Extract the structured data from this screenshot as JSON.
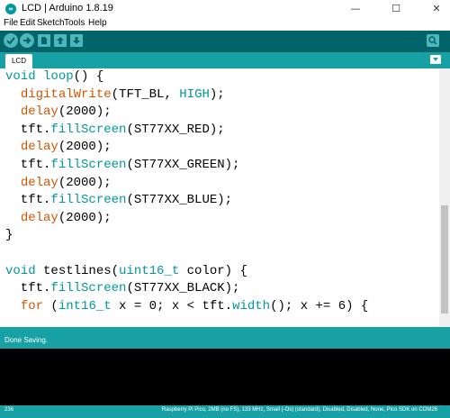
{
  "window": {
    "title": "LCD | Arduino 1.8.19",
    "icon_label": "∞",
    "minimize": "—",
    "maximize": "☐",
    "close": "✕"
  },
  "menu": {
    "items": [
      {
        "label": "File"
      },
      {
        "label": "Edit"
      },
      {
        "label": "Sketch"
      },
      {
        "label": "Tools"
      },
      {
        "label": "Help"
      }
    ]
  },
  "toolbar": {
    "icons": [
      "verify-icon",
      "upload-icon",
      "new-icon",
      "open-icon",
      "save-icon",
      "serial-monitor-icon"
    ]
  },
  "tabs": [
    {
      "label": "LCD"
    }
  ],
  "code": {
    "lines": [
      [
        {
          "t": "void",
          "c": "kw"
        },
        {
          "t": " "
        },
        {
          "t": "loop",
          "c": "kw"
        },
        {
          "t": "() {"
        }
      ],
      [
        {
          "t": "  "
        },
        {
          "t": "digitalWrite",
          "c": "fn"
        },
        {
          "t": "(TFT_BL, "
        },
        {
          "t": "HIGH",
          "c": "kw"
        },
        {
          "t": ");"
        }
      ],
      [
        {
          "t": "  "
        },
        {
          "t": "delay",
          "c": "fn"
        },
        {
          "t": "(2000);"
        }
      ],
      [
        {
          "t": "  tft."
        },
        {
          "t": "fillScreen",
          "c": "kw"
        },
        {
          "t": "(ST77XX_RED);"
        }
      ],
      [
        {
          "t": "  "
        },
        {
          "t": "delay",
          "c": "fn"
        },
        {
          "t": "(2000);"
        }
      ],
      [
        {
          "t": "  tft."
        },
        {
          "t": "fillScreen",
          "c": "kw"
        },
        {
          "t": "(ST77XX_GREEN);"
        }
      ],
      [
        {
          "t": "  "
        },
        {
          "t": "delay",
          "c": "fn"
        },
        {
          "t": "(2000);"
        }
      ],
      [
        {
          "t": "  tft."
        },
        {
          "t": "fillScreen",
          "c": "kw"
        },
        {
          "t": "(ST77XX_BLUE);"
        }
      ],
      [
        {
          "t": "  "
        },
        {
          "t": "delay",
          "c": "fn"
        },
        {
          "t": "(2000);"
        }
      ],
      [
        {
          "t": "}"
        }
      ],
      [
        {
          "t": ""
        }
      ],
      [
        {
          "t": "void",
          "c": "kw"
        },
        {
          "t": " testlines("
        },
        {
          "t": "uint16_t",
          "c": "kw"
        },
        {
          "t": " color) {"
        }
      ],
      [
        {
          "t": "  tft."
        },
        {
          "t": "fillScreen",
          "c": "kw"
        },
        {
          "t": "(ST77XX_BLACK);"
        }
      ],
      [
        {
          "t": "  "
        },
        {
          "t": "for",
          "c": "fn"
        },
        {
          "t": " ("
        },
        {
          "t": "int16_t",
          "c": "kw"
        },
        {
          "t": " x = 0; x < tft."
        },
        {
          "t": "width",
          "c": "kw"
        },
        {
          "t": "(); x += 6) {"
        }
      ]
    ]
  },
  "status": {
    "message": "Done Saving."
  },
  "footer": {
    "line_number": "236",
    "board": "Raspberry Pi Pico, 2MB (no FS), 133 MHz, Small (-Os) (standard), Disabled, Disabled, None, Pico SDK on COM26"
  },
  "colors": {
    "toolbar": "#006468",
    "accent": "#17a1a5",
    "keyword": "#00979c",
    "function": "#d35400"
  }
}
